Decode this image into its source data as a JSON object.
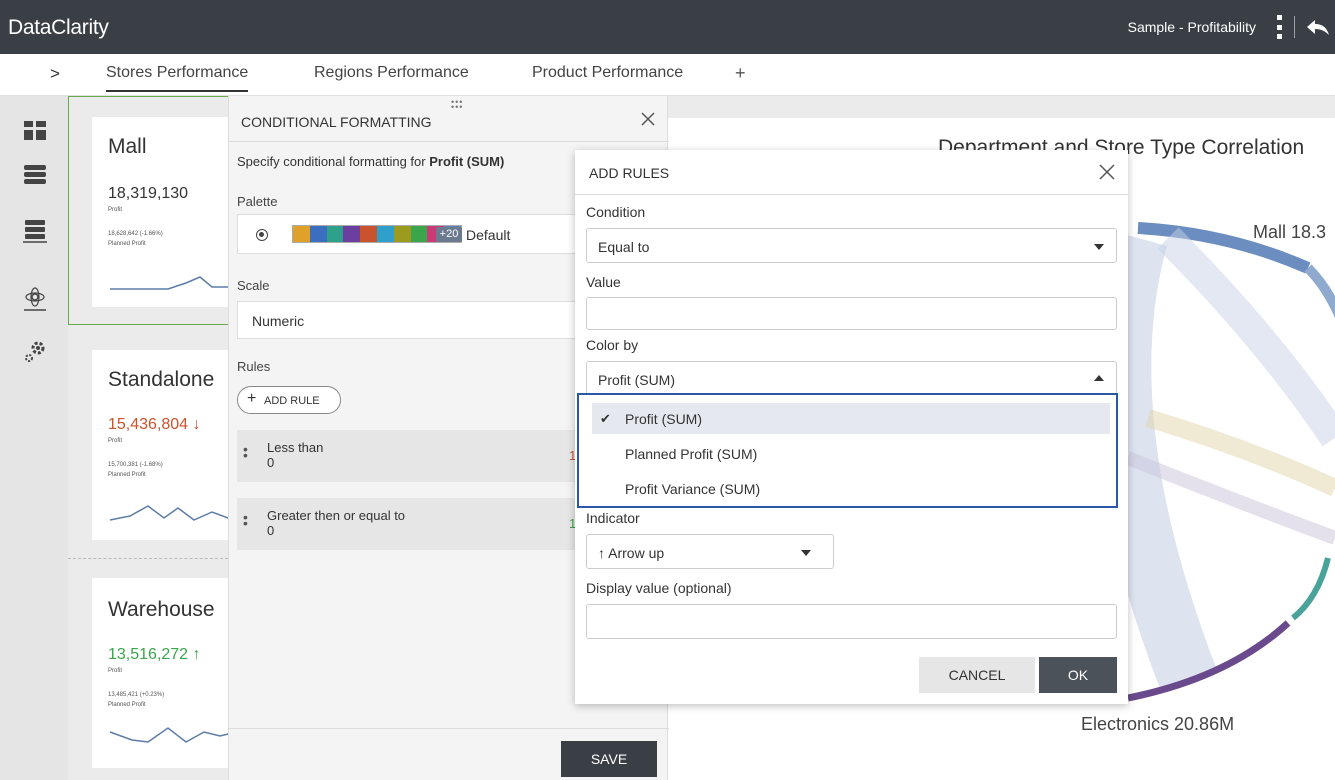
{
  "app": {
    "brand": "DataClarity",
    "report_name": "Sample - Profitability"
  },
  "tabs": {
    "expand": ">",
    "items": [
      "Stores Performance",
      "Regions Performance",
      "Product Performance"
    ],
    "add": "+"
  },
  "sidebar": {
    "icons": [
      "dashboard-icon",
      "data-table-icon",
      "server-icon",
      "network-icon",
      "settings-icon"
    ]
  },
  "kpis": [
    {
      "title": "Mall",
      "value": "18,319,130",
      "value_label": "Profit",
      "planned": "18,628,642 (-1.66%)",
      "planned_label": "Planned Profit",
      "value_color": "#333333"
    },
    {
      "title": "Standalone",
      "value": "15,436,804 ↓",
      "value_label": "Profit",
      "planned": "15,700,381 (-1.68%)",
      "planned_label": "Planned Profit",
      "value_color": "#c9532c"
    },
    {
      "title": "Warehouse",
      "value": "13,516,272 ↑",
      "value_label": "Profit",
      "planned": "13,485,421 (+0.23%)",
      "planned_label": "Planned Profit",
      "value_color": "#3aa54a"
    }
  ],
  "chart": {
    "title": "Department and Store Type Correlation",
    "label_mall": "Mall 18.3",
    "label_electronics": "Electronics 20.86M"
  },
  "conditional_formatting": {
    "title": "CONDITIONAL FORMATTING",
    "description_prefix": "Specify conditional formatting for ",
    "description_field": "Profit (SUM)",
    "palette_label": "Palette",
    "palette_colors": [
      "#e0a12b",
      "#3a6fbf",
      "#2fa08a",
      "#6b3fa0",
      "#c9532c",
      "#2fa0c9",
      "#9b9b1f",
      "#3aa54a",
      "#c93a76",
      "#5c7fbf"
    ],
    "palette_extra": "+20",
    "palette_name": "Default",
    "scale_label": "Scale",
    "scale_value": "Numeric",
    "rules_label": "Rules",
    "add_rule_plus": "+",
    "add_rule_label": "ADD RULE",
    "rules": [
      {
        "condition": "Less than",
        "value": "0",
        "index": "1",
        "index_color": "#c9532c"
      },
      {
        "condition": "Greater then or equal to",
        "value": "0",
        "index": "1",
        "index_color": "#3aa54a"
      }
    ],
    "save_label": "SAVE"
  },
  "add_rules": {
    "title": "ADD RULES",
    "condition_label": "Condition",
    "condition_value": "Equal to",
    "value_label": "Value",
    "value_value": "",
    "color_by_label": "Color by",
    "color_by_value": "Profit (SUM)",
    "color_by_options": [
      "Profit (SUM)",
      "Planned Profit (SUM)",
      "Profit Variance (SUM)"
    ],
    "selected_check": "✔",
    "indicator_label": "Indicator",
    "indicator_value": "↑ Arrow up",
    "display_value_label": "Display value (optional)",
    "display_value_value": "",
    "cancel_label": "CANCEL",
    "ok_label": "OK"
  }
}
